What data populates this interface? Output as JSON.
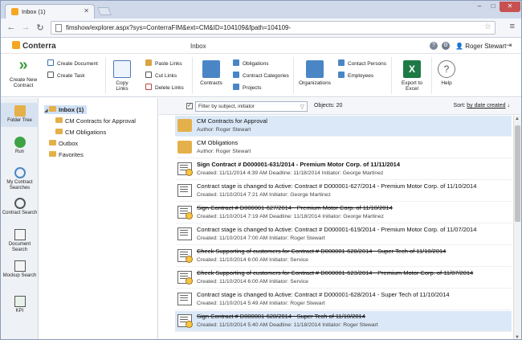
{
  "browser": {
    "tab_title": "Inbox (1)",
    "url_host": "fimshow/explorer.aspx?sys=ConterraFIM&ext=CM&ID=104109&fpath=104109-",
    "url_rest": ""
  },
  "header": {
    "logo": "Conterra",
    "title": "Inbox",
    "user": "Roger Stewart"
  },
  "ribbon": {
    "create_new_contract": "Create New Contract",
    "create_document": "Create Document",
    "create_task": "Create Task",
    "copy_links": "Copy Links",
    "paste_links": "Paste Links",
    "cut_links": "Cut Links",
    "delete_links": "Delete Links",
    "contracts": "Contracts",
    "obligations": "Obligations",
    "contract_categories": "Contract Categories",
    "projects": "Projects",
    "organizations": "Organizations",
    "contact_persons": "Contact Persons",
    "employees": "Employees",
    "export_to_excel": "Export to Excel",
    "help": "Help"
  },
  "leftnav": {
    "folder_tree": "Folder Tree",
    "run": "Run",
    "my_contract_searches": "My Contract Searches",
    "contract_search": "Contract Search",
    "document_search": "Document Search",
    "mockup_search": "Mockup Search",
    "kpi": "KPI"
  },
  "tree": {
    "inbox": "Inbox (1)",
    "cm_contracts": "CM Contracts for Approval",
    "cm_obligations": "CM Obligations",
    "outbox": "Outbox",
    "favorites": "Favorites"
  },
  "list": {
    "filter_placeholder": "Filter by subject, initiator",
    "objects": "Objects: 20",
    "sort_label": "Sort: ",
    "sort_value": "by date created",
    "rows": [
      {
        "title": "CM Contracts for Approval",
        "sub": "Author: Roger Stewart"
      },
      {
        "title": "CM Obligations",
        "sub": "Author: Roger Stewart"
      },
      {
        "title": "Sign Contract # D000001-631/2014 - Premium Motor Corp. of 11/11/2014",
        "sub": "Created: 11/11/2014 4:39 AM    Deadline: 11/18/2014    Initiator: George Martinez"
      },
      {
        "title": "Contract stage is changed to Active: Contract # D000001-627/2014 - Premium Motor Corp. of 11/10/2014",
        "sub": "Created: 11/10/2014 7:21 AM    Initiator: George Martinez"
      },
      {
        "title": "Sign Contract # D000001-627/2014 - Premium Motor Corp. of 11/10/2014",
        "sub": "Created: 11/10/2014 7:19 AM    Deadline: 11/18/2014    Initiator: George Martinez"
      },
      {
        "title": "Contract stage is changed to Active: Contract # D000001-619/2014 - Premium Motor Corp. of 11/07/2014",
        "sub": "Created: 11/10/2014 7:00 AM    Initiator: Roger Stewart"
      },
      {
        "title": "Check Supporting of customers for Contract # D000001-628/2014 - Super Tech of 11/10/2014",
        "sub": "Created: 11/10/2014 6:00 AM    Initiator: Service"
      },
      {
        "title": "Check Supporting of customers for Contract # D000001-623/2014 - Premium Motor Corp. of 11/07/2014",
        "sub": "Created: 11/10/2014 6:00 AM    Initiator: Service"
      },
      {
        "title": "Contract stage is changed to Active: Contract # D000001-628/2014 - Super Tech of 11/10/2014",
        "sub": "Created: 11/10/2014 5:49 AM    Initiator: Roger Stewart"
      },
      {
        "title": "Sign Contract # D000001-628/2014 - Super Tech of 11/10/2014",
        "sub": "Created: 11/10/2014 5:40 AM    Deadline: 11/18/2014    Initiator: Roger Stewart"
      }
    ]
  }
}
